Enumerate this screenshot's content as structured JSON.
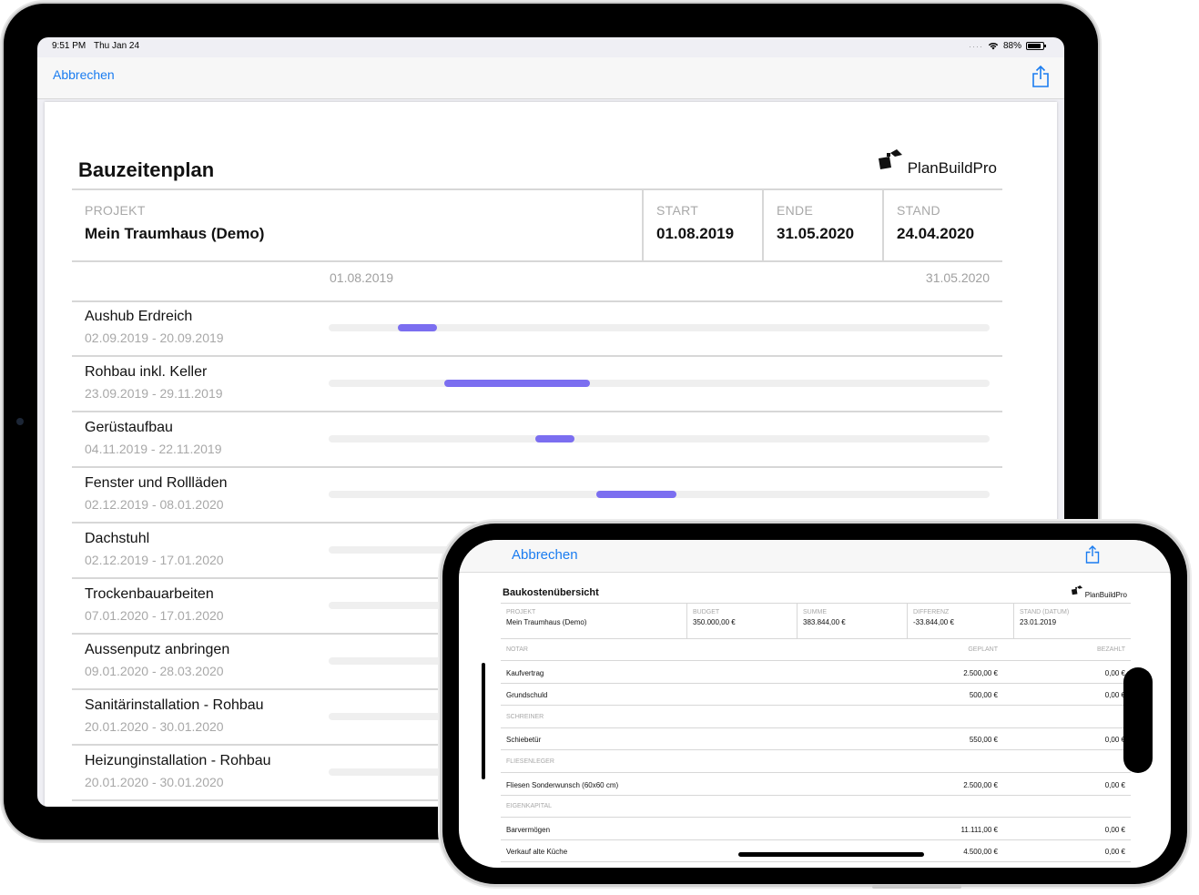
{
  "ipad": {
    "status": {
      "time": "9:51 PM",
      "date": "Thu Jan 24",
      "battery": "88%",
      "battery_level": 0.88
    },
    "nav": {
      "cancel": "Abbrechen"
    },
    "doc": {
      "title": "Bauzeitenplan",
      "logo_text": "PlanBuildPro",
      "info": [
        {
          "label": "PROJEKT",
          "value": "Mein Traumhaus (Demo)"
        },
        {
          "label": "START",
          "value": "01.08.2019"
        },
        {
          "label": "ENDE",
          "value": "31.05.2020"
        },
        {
          "label": "STAND",
          "value": "24.04.2020"
        }
      ],
      "timeline_start": "01.08.2019",
      "timeline_end": "31.05.2020",
      "tasks": [
        {
          "name": "Aushub Erdreich",
          "dates": "02.09.2019 - 20.09.2019",
          "from": "2019-09-02",
          "to": "2019-09-20"
        },
        {
          "name": "Rohbau inkl. Keller",
          "dates": "23.09.2019 - 29.11.2019",
          "from": "2019-09-23",
          "to": "2019-11-29"
        },
        {
          "name": "Gerüstaufbau",
          "dates": "04.11.2019 - 22.11.2019",
          "from": "2019-11-04",
          "to": "2019-11-22"
        },
        {
          "name": "Fenster und Rollläden",
          "dates": "02.12.2019 - 08.01.2020",
          "from": "2019-12-02",
          "to": "2020-01-08"
        },
        {
          "name": "Dachstuhl",
          "dates": "02.12.2019 - 17.01.2020",
          "from": "2019-12-02",
          "to": "2020-01-17"
        },
        {
          "name": "Trockenbauarbeiten",
          "dates": "07.01.2020 - 17.01.2020",
          "from": "2020-01-07",
          "to": "2020-01-17"
        },
        {
          "name": "Aussenputz anbringen",
          "dates": "09.01.2020 - 28.03.2020",
          "from": "2020-01-09",
          "to": "2020-03-28"
        },
        {
          "name": "Sanitärinstallation - Rohbau",
          "dates": "20.01.2020 - 30.01.2020",
          "from": "2020-01-20",
          "to": "2020-01-30"
        },
        {
          "name": "Heizunginstallation - Rohbau",
          "dates": "20.01.2020 - 30.01.2020",
          "from": "2020-01-20",
          "to": "2020-01-30"
        }
      ]
    }
  },
  "iphone": {
    "nav": {
      "cancel": "Abbrechen"
    },
    "doc": {
      "title": "Baukostenübersicht",
      "logo_text": "PlanBuildPro",
      "info": [
        {
          "label": "PROJEKT",
          "value": "Mein Traumhaus (Demo)"
        },
        {
          "label": "BUDGET",
          "value": "350.000,00 €"
        },
        {
          "label": "SUMME",
          "value": "383.844,00 €"
        },
        {
          "label": "DIFFERENZ",
          "value": "-33.844,00 €"
        },
        {
          "label": "STAND (DATUM)",
          "value": "23.01.2019"
        }
      ],
      "rows": [
        {
          "type": "section",
          "c1": "NOTAR",
          "c2": "GEPLANT",
          "c3": "BEZAHLT"
        },
        {
          "type": "item",
          "c1": "Kaufvertrag",
          "c2": "2.500,00 €",
          "c3": "0,00 €"
        },
        {
          "type": "item",
          "c1": "Grundschuld",
          "c2": "500,00 €",
          "c3": "0,00 €"
        },
        {
          "type": "section",
          "c1": "SCHREINER",
          "c2": "",
          "c3": ""
        },
        {
          "type": "item",
          "c1": "Schiebetür",
          "c2": "550,00 €",
          "c3": "0,00 €"
        },
        {
          "type": "section",
          "c1": "FLIESENLEGER",
          "c2": "",
          "c3": ""
        },
        {
          "type": "item",
          "c1": "Fliesen Sonderwunsch (60x60 cm)",
          "c2": "2.500,00 €",
          "c3": "0,00 €"
        },
        {
          "type": "section",
          "c1": "EIGENKAPITAL",
          "c2": "",
          "c3": ""
        },
        {
          "type": "item",
          "c1": "Barvermögen",
          "c2": "11.111,00 €",
          "c3": "0,00 €"
        },
        {
          "type": "item",
          "c1": "Verkauf alte Küche",
          "c2": "4.500,00 €",
          "c3": "0,00 €"
        }
      ]
    }
  },
  "colors": {
    "accent": "#1a7cf0",
    "bar": "#7b6ef0",
    "track": "#efefef"
  },
  "icons": {
    "share": "share-icon",
    "logo": "planbuildpro-logo-icon",
    "wifi": "wifi-icon",
    "battery": "battery-icon"
  }
}
